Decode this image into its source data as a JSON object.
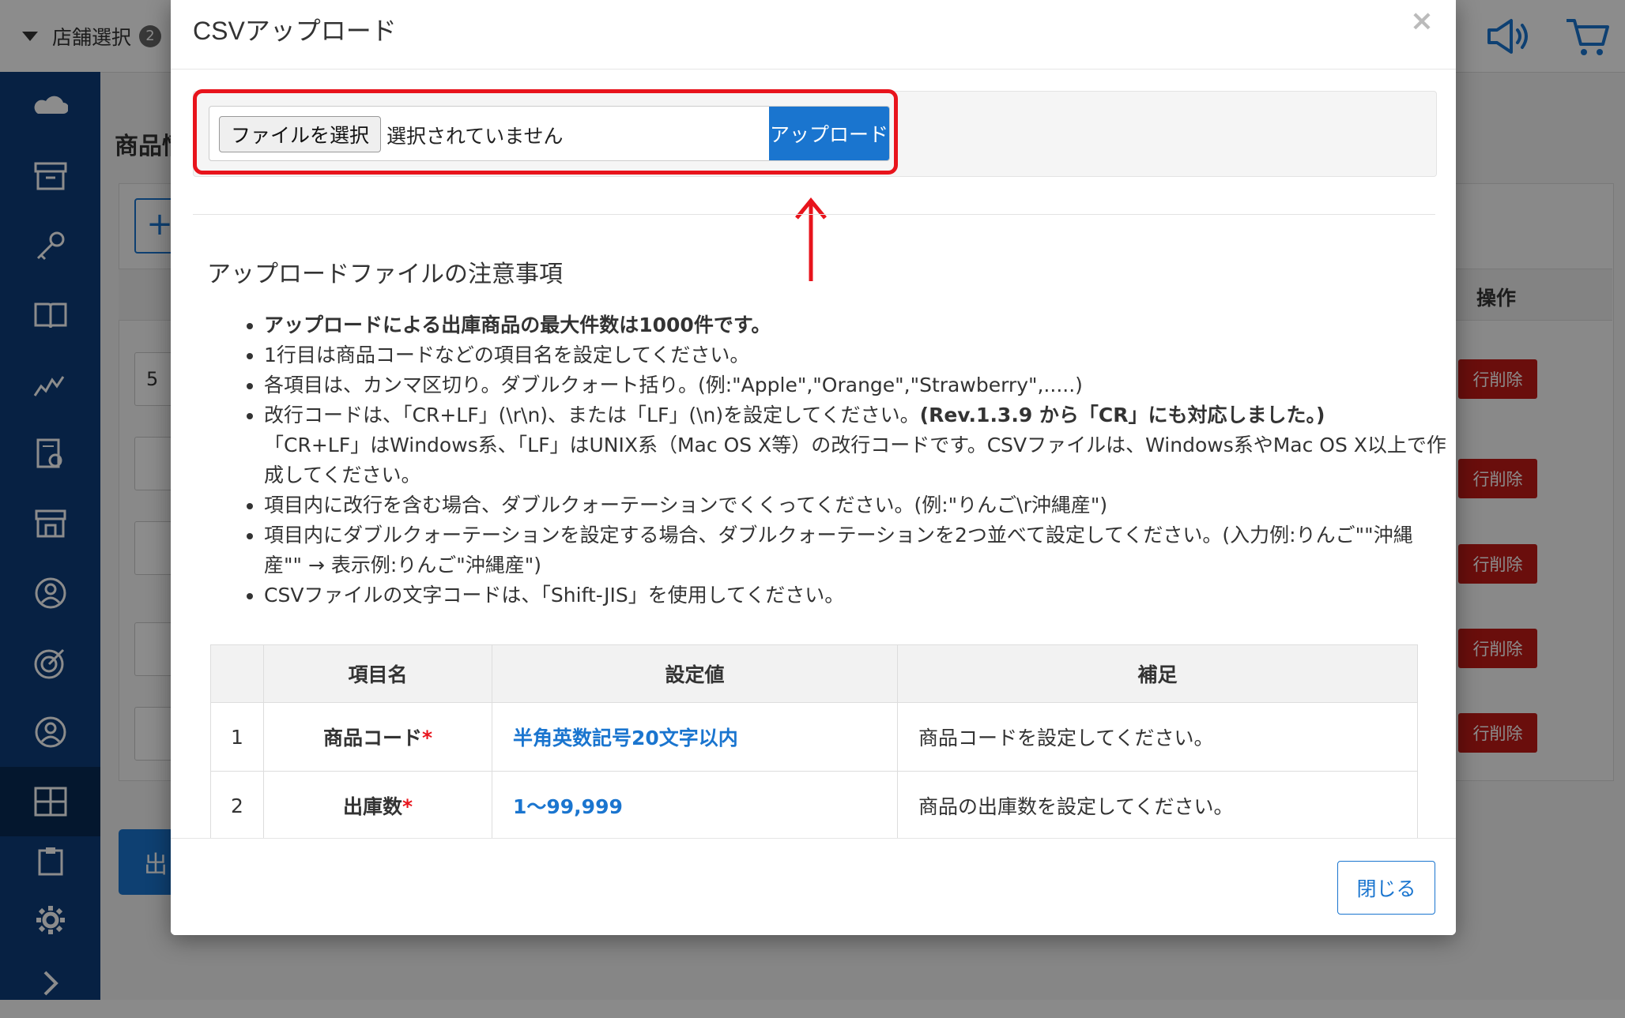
{
  "topbar": {
    "store_select_label": "店舗選択",
    "store_count": "2"
  },
  "sidebar": {
    "items": [
      "cloud-icon",
      "archive-icon",
      "key-icon",
      "book-icon",
      "chart-icon",
      "report-icon",
      "store-icon",
      "user-circle-icon",
      "target-icon",
      "account-icon",
      "grid-icon",
      "clipboard-icon",
      "gear-icon",
      "expand-icon"
    ]
  },
  "background": {
    "page_title": "商品情",
    "add_symbol": "+",
    "ops_header": "操作",
    "delete_label": "行削除",
    "first_qty": "5",
    "ship_button": "出"
  },
  "modal": {
    "title": "CSVアップロード",
    "close_symbol": "×",
    "file_button": "ファイルを選択",
    "file_status": "選択されていません",
    "upload_button": "アップロード",
    "notes_heading": "アップロードファイルの注意事項",
    "notes": {
      "n1": "アップロードによる出庫商品の最大件数は1000件です。",
      "n2": "1行目は商品コードなどの項目名を設定してください。",
      "n3": "各項目は、カンマ区切り。ダブルクォート括り。(例:\"Apple\",\"Orange\",\"Strawberry\",.....)",
      "n4a": "改行コードは、「CR+LF」(\\r\\n)、または「LF」(\\n)を設定してください。",
      "n4b": "(Rev.1.3.9 から「CR」にも対応しました。)",
      "n4c": "「CR+LF」はWindows系、「LF」はUNIX系（Mac OS X等）の改行コードです。CSVファイルは、Windows系やMac OS X以上で作成してください。",
      "n5": "項目内に改行を含む場合、ダブルクォーテーションでくくってください。(例:\"りんご\\r沖縄産\")",
      "n6": "項目内にダブルクォーテーションを設定する場合、ダブルクォーテーションを2つ並べて設定してください。(入力例:りんご\"\"沖縄産\"\" → 表示例:りんご\"沖縄産\")",
      "n7": "CSVファイルの文字コードは、「Shift-JIS」を使用してください。"
    },
    "table": {
      "headers": [
        "",
        "項目名",
        "設定値",
        "補足"
      ],
      "rows": [
        {
          "no": "1",
          "name": "商品コード",
          "required": "*",
          "value": "半角英数記号20文字以内",
          "note": "商品コードを設定してください。"
        },
        {
          "no": "2",
          "name": "出庫数",
          "required": "*",
          "value": "1〜99,999",
          "note": "商品の出庫数を設定してください。"
        }
      ]
    },
    "close_button": "閉じる"
  },
  "colors": {
    "primary": "#1a75cf",
    "danger": "#c11b17",
    "highlight": "#e8141c",
    "sidebar": "#0d3d7a"
  }
}
